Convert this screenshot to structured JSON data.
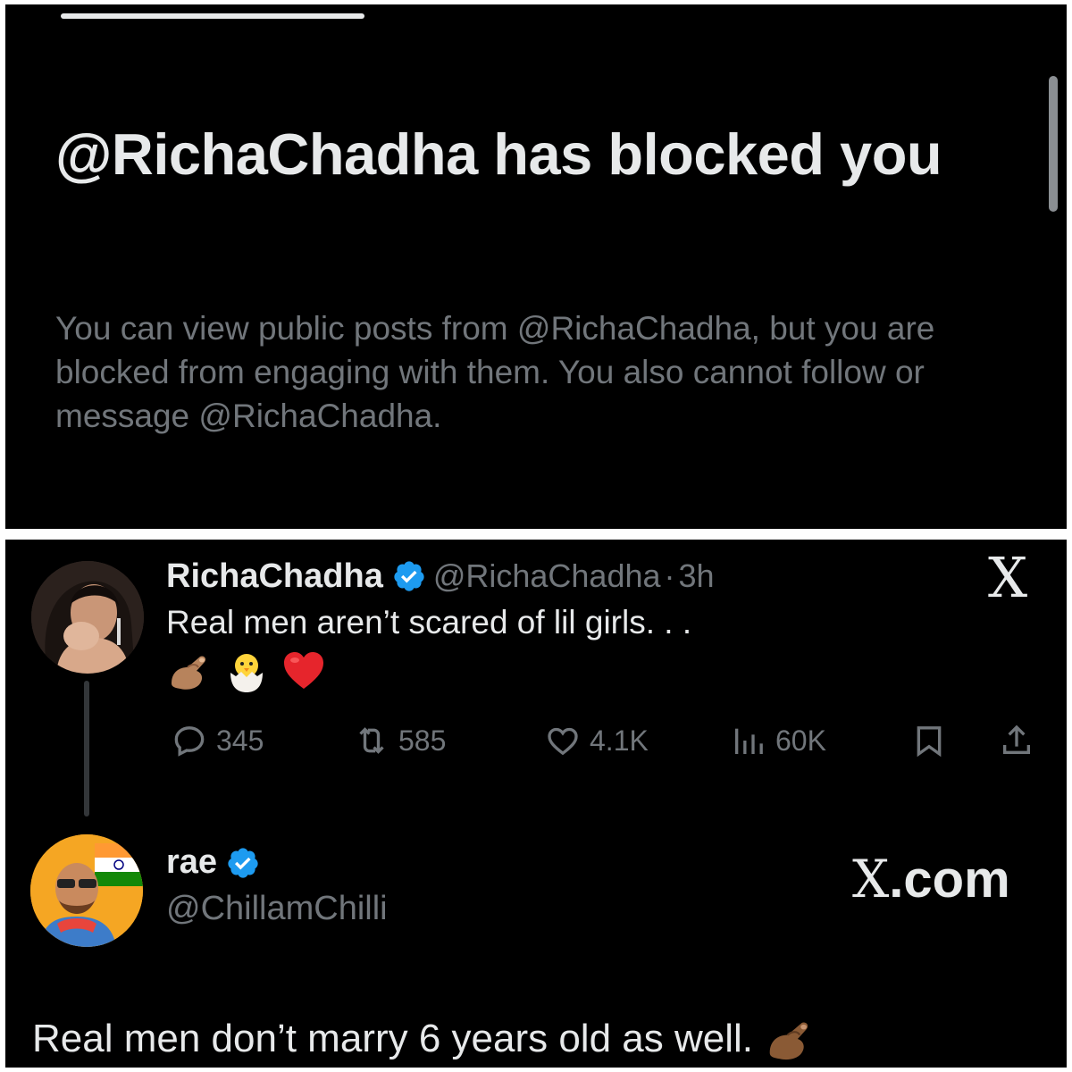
{
  "block_notice": {
    "title": "@RichaChadha has blocked you",
    "description": "You can view public posts from @RichaChadha, but you are blocked from engaging with them. You also cannot follow or message @RichaChadha."
  },
  "tweet": {
    "display_name": "RichaChadha",
    "handle": "@RichaChadha",
    "separator": "·",
    "time": "3h",
    "text": "Real men aren’t scared of lil girls. . .",
    "emojis": [
      "pinching-hand-emoji",
      "hatching-chick-emoji",
      "red-heart-emoji"
    ],
    "stats": {
      "replies": "345",
      "reposts": "585",
      "likes": "4.1K",
      "views": "60K"
    }
  },
  "reply": {
    "display_name": "rae",
    "handle": "@ChillamChilli",
    "watermark": ".com",
    "watermark_x": "X",
    "text": "Real men don’t marry 6 years old as well."
  },
  "icons": {
    "x_logo": "X",
    "verified_color": "#1d9bf0"
  },
  "colors": {
    "background": "#000000",
    "primary_text": "#e7e9ea",
    "secondary_text": "#71767b"
  }
}
